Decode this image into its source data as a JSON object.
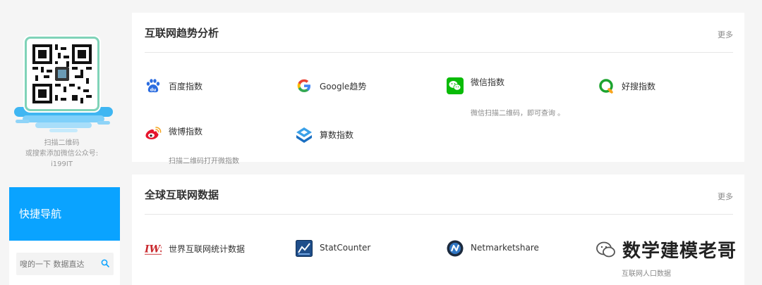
{
  "sidebar": {
    "qr_caption": [
      "扫描二维码",
      "或搜索添加微信公众号:",
      "i199IT"
    ],
    "nav_title": "快捷导航",
    "search_placeholder": "嗖的一下 数据直达"
  },
  "section_trends": {
    "title": "互联网趋势分析",
    "more": "更多",
    "items": [
      {
        "label": "百度指数",
        "icon": "baidu-icon"
      },
      {
        "label": "Google趋势",
        "icon": "google-icon"
      },
      {
        "label": "微信指数",
        "icon": "wechat-icon",
        "sub": "微信扫描二维码，即可查询 。"
      },
      {
        "label": "好搜指数",
        "icon": "haosou-icon"
      },
      {
        "label": "微博指数",
        "icon": "weibo-icon",
        "sub": "扫描二维码打开微指数"
      },
      {
        "label": "算数指数",
        "icon": "suanshu-icon"
      }
    ]
  },
  "section_global": {
    "title": "全球互联网数据",
    "more": "更多",
    "items": [
      {
        "label": "世界互联网统计数据",
        "icon": "iws-icon"
      },
      {
        "label": "StatCounter",
        "icon": "statcounter-icon"
      },
      {
        "label": "Netmarketshare",
        "icon": "netmarketshare-icon"
      },
      {
        "label": "互联网人口数据",
        "icon": "population-icon"
      }
    ]
  },
  "watermark": {
    "text": "数学建模老哥",
    "icon": "wechat-bubble-icon"
  },
  "colors": {
    "accent": "#0aa3ff",
    "page_bg": "#f5f5f5",
    "qr_border": "#7fd3b8"
  }
}
